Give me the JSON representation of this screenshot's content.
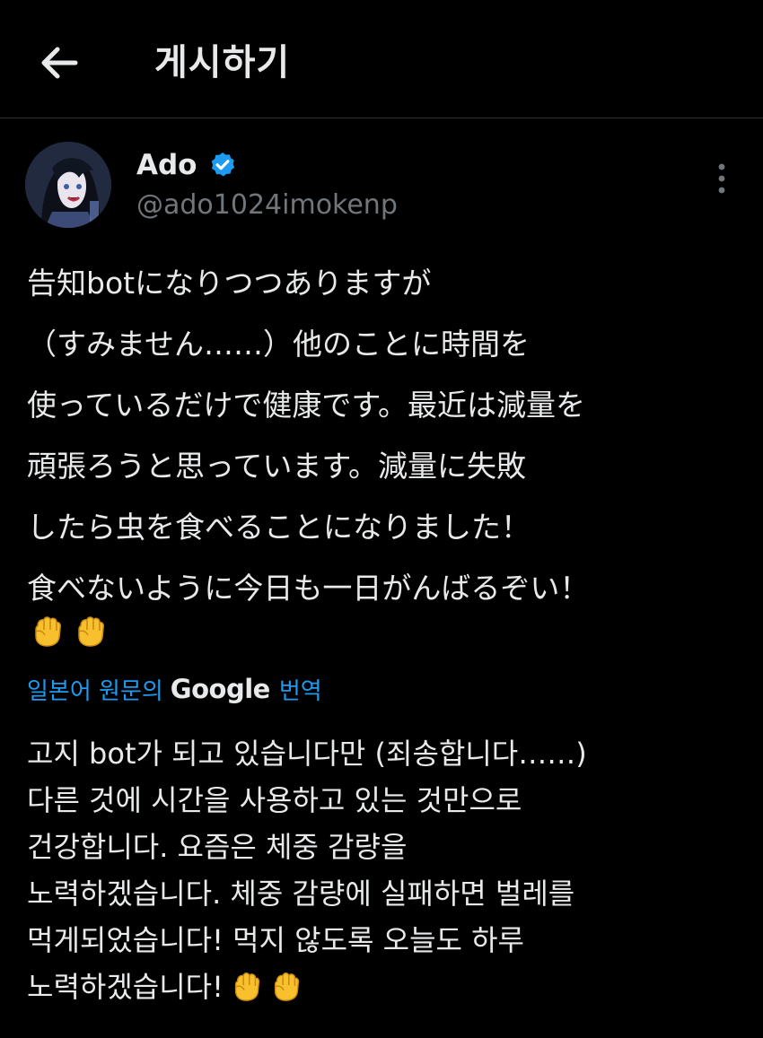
{
  "header": {
    "title": "게시하기",
    "back_icon": "arrow-left-icon"
  },
  "author": {
    "display_name": "Ado",
    "handle": "@ado1024imokenp",
    "verified_icon": "verified-badge-icon",
    "verified_color": "#1d9bf0",
    "more_icon": "more-vertical-icon"
  },
  "post": {
    "lines": [
      "告知botになりつつありますが",
      "（すみません……）他のことに時間を",
      "使っているだけで健康です。最近は減量を",
      "頑張ろうと思っています。減量に失敗",
      "したら虫を食べることになりました！",
      "食べないように今日も一日がんばるぞい！"
    ],
    "emojis": [
      "raised-fist-emoji",
      "raised-fist-emoji"
    ]
  },
  "translation": {
    "prefix": "일본어 원문의",
    "provider": "Google",
    "suffix": "번역",
    "lines": [
      "고지 bot가 되고 있습니다만 (죄송합니다……)",
      "다른 것에 시간을 사용하고 있는 것만으로",
      "건강합니다. 요즘은 체중 감량을",
      "노력하겠습니다. 체중 감량에 실패하면 벌레를",
      "먹게되었습니다! 먹지 않도록 오늘도 하루",
      "노력하겠습니다!"
    ],
    "emojis": [
      "raised-fist-emoji",
      "raised-fist-emoji"
    ]
  },
  "colors": {
    "background": "#000000",
    "text": "#e7e9ea",
    "secondary_text": "#71767b",
    "accent": "#1d9bf0",
    "divider": "#2f3336"
  }
}
